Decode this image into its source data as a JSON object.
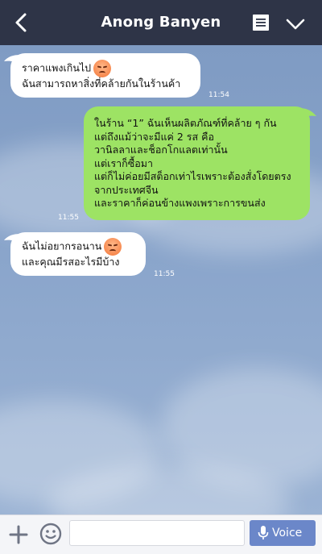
{
  "header": {
    "title": "Anong Banyen",
    "back_icon": "chevron-left-icon",
    "notes_icon": "notes-icon",
    "menu_icon": "chevron-down-icon",
    "bg_color": "#2e3447"
  },
  "messages": [
    {
      "side": "in",
      "lines": [
        "ราคาแพงเกินไป",
        "ฉันสามารถหาสิ่งที่คล้ายกันในร้านค้า"
      ],
      "emoji": "sad-face-emoji",
      "time": "11:54"
    },
    {
      "side": "out",
      "lines": [
        "ในร้าน “1” ฉันเห็นผลิตภัณฑ์ที่คล้าย ๆ กัน",
        "แต่ถึงแม้ว่าจะมีแค่ 2 รส คือ",
        "วานิลลาและช็อกโกแลตเท่านั้น",
        "แต่เราก็ซื้อมา",
        "แต่ก็ไม่ค่อยมีสต็อกเท่าไรเพราะต้องสั่งโดยตรง",
        "จากประเทศจีน",
        "และราคาก็ค่อนข้างแพงเพราะการขนส่ง"
      ],
      "time": "11:55"
    },
    {
      "side": "in",
      "lines": [
        "ฉันไม่อยากรอนาน",
        "และคุณมีรสอะไรมีบ้าง"
      ],
      "emoji": "sad-face-emoji",
      "time": "11:55"
    }
  ],
  "composer": {
    "input_value": "",
    "voice_label": "Voice",
    "plus_icon": "plus-icon",
    "emoji_icon": "smiley-icon",
    "mic_icon": "microphone-icon"
  },
  "colors": {
    "incoming_bubble": "#ffffff",
    "outgoing_bubble": "#9de364",
    "voice_button": "#6b87c9"
  }
}
